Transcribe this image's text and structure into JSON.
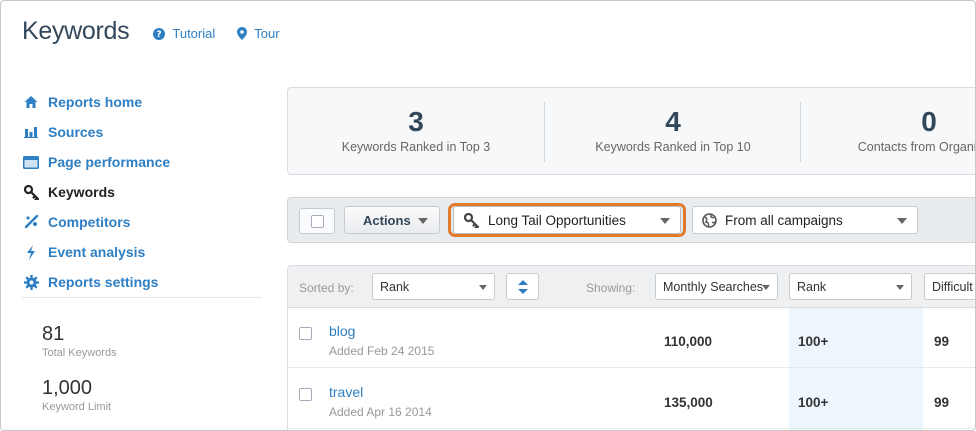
{
  "header": {
    "title": "Keywords",
    "tutorial_label": "Tutorial",
    "tour_label": "Tour"
  },
  "sidebar": {
    "items": [
      {
        "label": "Reports home",
        "icon": "home-icon"
      },
      {
        "label": "Sources",
        "icon": "bar-chart-icon"
      },
      {
        "label": "Page performance",
        "icon": "browser-window-icon"
      },
      {
        "label": "Keywords",
        "icon": "key-icon",
        "active": true
      },
      {
        "label": "Competitors",
        "icon": "competitors-icon"
      },
      {
        "label": "Event analysis",
        "icon": "lightning-icon"
      },
      {
        "label": "Reports settings",
        "icon": "gear-icon"
      }
    ],
    "stats": [
      {
        "value": "81",
        "label": "Total Keywords"
      },
      {
        "value": "1,000",
        "label": "Keyword Limit"
      }
    ]
  },
  "summary": [
    {
      "value": "3",
      "label": "Keywords Ranked in Top 3"
    },
    {
      "value": "4",
      "label": "Keywords Ranked in Top 10"
    },
    {
      "value": "0",
      "label": "Contacts from Organic La"
    }
  ],
  "toolbar": {
    "actions_label": "Actions",
    "filter_value": "Long Tail Opportunities",
    "campaign_value": "From all campaigns"
  },
  "table": {
    "sorted_by_label": "Sorted by:",
    "sort_value": "Rank",
    "showing_label": "Showing:",
    "columns": [
      "Monthly Searches",
      "Rank",
      "Difficult"
    ],
    "rows": [
      {
        "keyword": "blog",
        "added": "Added Feb 24 2015",
        "searches": "110,000",
        "rank": "100+",
        "difficulty": "99"
      },
      {
        "keyword": "travel",
        "added": "Added Apr 16 2014",
        "searches": "135,000",
        "rank": "100+",
        "difficulty": "99"
      }
    ]
  },
  "colors": {
    "link_blue": "#2e7fc3",
    "highlight_orange": "#e07a2e",
    "rank_column_bg": "#eef6fd"
  }
}
